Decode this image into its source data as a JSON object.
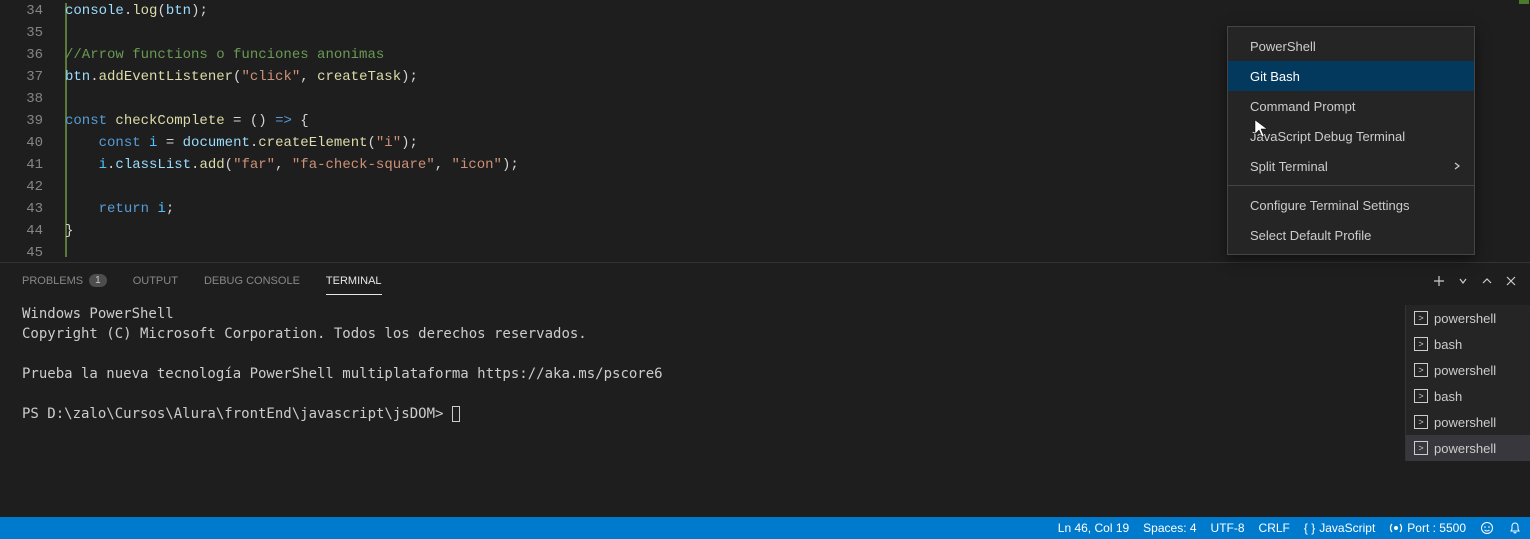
{
  "code_lines": [
    {
      "n": 34,
      "html": "<span class='tok-obj'>console</span><span class='tok-punc'>.</span><span class='tok-fn'>log</span><span class='tok-punc'>(</span><span class='tok-obj'>btn</span><span class='tok-punc'>);</span>"
    },
    {
      "n": 35,
      "html": ""
    },
    {
      "n": 36,
      "html": "<span class='tok-comment'>//Arrow functions o funciones anonimas</span>"
    },
    {
      "n": 37,
      "html": "<span class='tok-obj'>btn</span><span class='tok-punc'>.</span><span class='tok-fn'>addEventListener</span><span class='tok-punc'>(</span><span class='tok-str'>\"click\"</span><span class='tok-punc'>, </span><span class='tok-fn'>createTask</span><span class='tok-punc'>);</span>"
    },
    {
      "n": 38,
      "html": ""
    },
    {
      "n": 39,
      "html": "<span class='tok-kw'>const</span> <span class='tok-fn'>checkComplete</span> <span class='tok-punc'>=</span> <span class='tok-punc'>()</span> <span class='tok-arrow'>=&gt;</span> <span class='tok-punc'>{</span>"
    },
    {
      "n": 40,
      "html": "    <span class='tok-kw'>const</span> <span class='tok-const'>i</span> <span class='tok-punc'>=</span> <span class='tok-obj'>document</span><span class='tok-punc'>.</span><span class='tok-fn'>createElement</span><span class='tok-punc'>(</span><span class='tok-str'>\"i\"</span><span class='tok-punc'>);</span>"
    },
    {
      "n": 41,
      "html": "    <span class='tok-const'>i</span><span class='tok-punc'>.</span><span class='tok-obj'>classList</span><span class='tok-punc'>.</span><span class='tok-fn'>add</span><span class='tok-punc'>(</span><span class='tok-str'>\"far\"</span><span class='tok-punc'>, </span><span class='tok-str'>\"fa-check-square\"</span><span class='tok-punc'>, </span><span class='tok-str'>\"icon\"</span><span class='tok-punc'>);</span>"
    },
    {
      "n": 42,
      "html": ""
    },
    {
      "n": 43,
      "html": "    <span class='tok-kw'>return</span> <span class='tok-const'>i</span><span class='tok-punc'>;</span>"
    },
    {
      "n": 44,
      "html": "<span class='tok-punc'>}</span>"
    },
    {
      "n": 45,
      "html": ""
    }
  ],
  "panel": {
    "tabs": {
      "problems": "PROBLEMS",
      "problems_count": "1",
      "output": "OUTPUT",
      "debug": "DEBUG CONSOLE",
      "terminal": "TERMINAL"
    }
  },
  "terminal": {
    "line1": "Windows PowerShell",
    "line2": "Copyright (C) Microsoft Corporation. Todos los derechos reservados.",
    "line3": "",
    "line4": "Prueba la nueva tecnología PowerShell multiplataforma https://aka.ms/pscore6",
    "line5": "",
    "prompt": "PS D:\\zalo\\Cursos\\Alura\\frontEnd\\javascript\\jsDOM> "
  },
  "term_list": [
    "powershell",
    "bash",
    "powershell",
    "bash",
    "powershell",
    "powershell"
  ],
  "dropdown": {
    "items": [
      "PowerShell",
      "Git Bash",
      "Command Prompt",
      "JavaScript Debug Terminal",
      "Split Terminal"
    ],
    "group2": [
      "Configure Terminal Settings",
      "Select Default Profile"
    ]
  },
  "status": {
    "pos": "Ln 46, Col 19",
    "spaces": "Spaces: 4",
    "encoding": "UTF-8",
    "eol": "CRLF",
    "lang": "JavaScript",
    "port": "Port : 5500"
  }
}
